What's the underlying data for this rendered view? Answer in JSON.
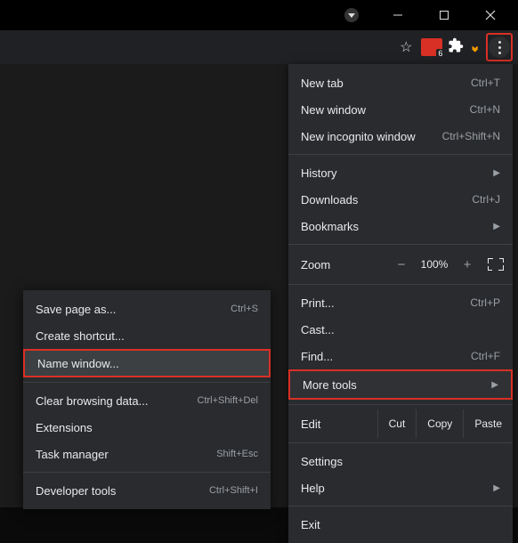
{
  "titlebar": {
    "account_icon": "account-dropdown"
  },
  "toolbar": {
    "star": "bookmark-star",
    "ext_count": "6",
    "puzzle": "extensions-icon",
    "chevrons": "chevrons-icon",
    "kebab": "chrome-menu"
  },
  "menu": {
    "items": [
      {
        "label": "New tab",
        "accel": "Ctrl+T"
      },
      {
        "label": "New window",
        "accel": "Ctrl+N"
      },
      {
        "label": "New incognito window",
        "accel": "Ctrl+Shift+N"
      }
    ],
    "section2": [
      {
        "label": "History",
        "arrow": true
      },
      {
        "label": "Downloads",
        "accel": "Ctrl+J"
      },
      {
        "label": "Bookmarks",
        "arrow": true
      }
    ],
    "zoom": {
      "label": "Zoom",
      "value": "100%"
    },
    "section3": [
      {
        "label": "Print...",
        "accel": "Ctrl+P"
      },
      {
        "label": "Cast..."
      },
      {
        "label": "Find...",
        "accel": "Ctrl+F"
      }
    ],
    "more_tools": {
      "label": "More tools"
    },
    "edit": {
      "label": "Edit",
      "cut": "Cut",
      "copy": "Copy",
      "paste": "Paste"
    },
    "section4": [
      {
        "label": "Settings"
      },
      {
        "label": "Help",
        "arrow": true
      }
    ],
    "exit": {
      "label": "Exit"
    }
  },
  "submenu": {
    "items1": [
      {
        "label": "Save page as...",
        "accel": "Ctrl+S"
      },
      {
        "label": "Create shortcut..."
      }
    ],
    "name_window": {
      "label": "Name window..."
    },
    "items2": [
      {
        "label": "Clear browsing data...",
        "accel": "Ctrl+Shift+Del"
      },
      {
        "label": "Extensions"
      },
      {
        "label": "Task manager",
        "accel": "Shift+Esc"
      }
    ],
    "dev": {
      "label": "Developer tools",
      "accel": "Ctrl+Shift+I"
    }
  }
}
